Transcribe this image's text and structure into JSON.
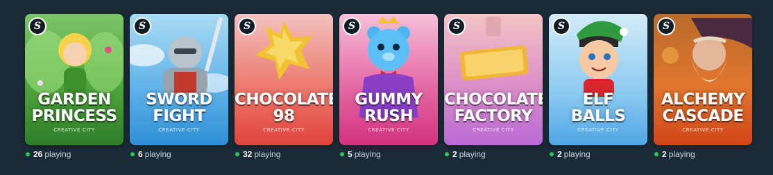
{
  "games": [
    {
      "title_line1": "GARDEN",
      "title_line2": "PRINCESS",
      "provider": "CREATIVE CITY",
      "playing_count": "26",
      "playing_label": "playing",
      "badge": "S",
      "bg_top": "#4ea53a",
      "bg_bottom": "#2f7d2a",
      "accent": "#f6d14a"
    },
    {
      "title_line1": "SWORD",
      "title_line2": "FIGHT",
      "provider": "CREATIVE CITY",
      "playing_count": "6",
      "playing_label": "playing",
      "badge": "S",
      "bg_top": "#8fd0f0",
      "bg_bottom": "#2f8ed6",
      "accent": "#b9c4cc"
    },
    {
      "title_line1": "CHOCOLATE",
      "title_line2": "98",
      "provider": "CREATIVE CITY",
      "playing_count": "32",
      "playing_label": "playing",
      "badge": "S",
      "bg_top": "#f2a6a0",
      "bg_bottom": "#e0443c",
      "accent": "#f2c230"
    },
    {
      "title_line1": "GUMMY",
      "title_line2": "RUSH",
      "provider": "CREATIVE CITY",
      "playing_count": "5",
      "playing_label": "playing",
      "badge": "S",
      "bg_top": "#f2a0c8",
      "bg_bottom": "#d4307e",
      "accent": "#4cb4f2"
    },
    {
      "title_line1": "CHOCOLATE",
      "title_line2": "FACTORY",
      "provider": "CREATIVE CITY",
      "playing_count": "2",
      "playing_label": "playing",
      "badge": "S",
      "bg_top": "#f0b2b8",
      "bg_bottom": "#b96ad6",
      "accent": "#f2b634"
    },
    {
      "title_line1": "ELF",
      "title_line2": "BALLS",
      "provider": "CREATIVE CITY",
      "playing_count": "2",
      "playing_label": "playing",
      "badge": "S",
      "bg_top": "#bfe4f6",
      "bg_bottom": "#4fa6e6",
      "accent": "#2f9a3e"
    },
    {
      "title_line1": "ALCHEMY",
      "title_line2": "CASCADE",
      "provider": "CREATIVE CITY",
      "playing_count": "2",
      "playing_label": "playing",
      "badge": "S",
      "bg_top": "#e08a3a",
      "bg_bottom": "#d2451a",
      "accent": "#e8d9c2"
    }
  ]
}
